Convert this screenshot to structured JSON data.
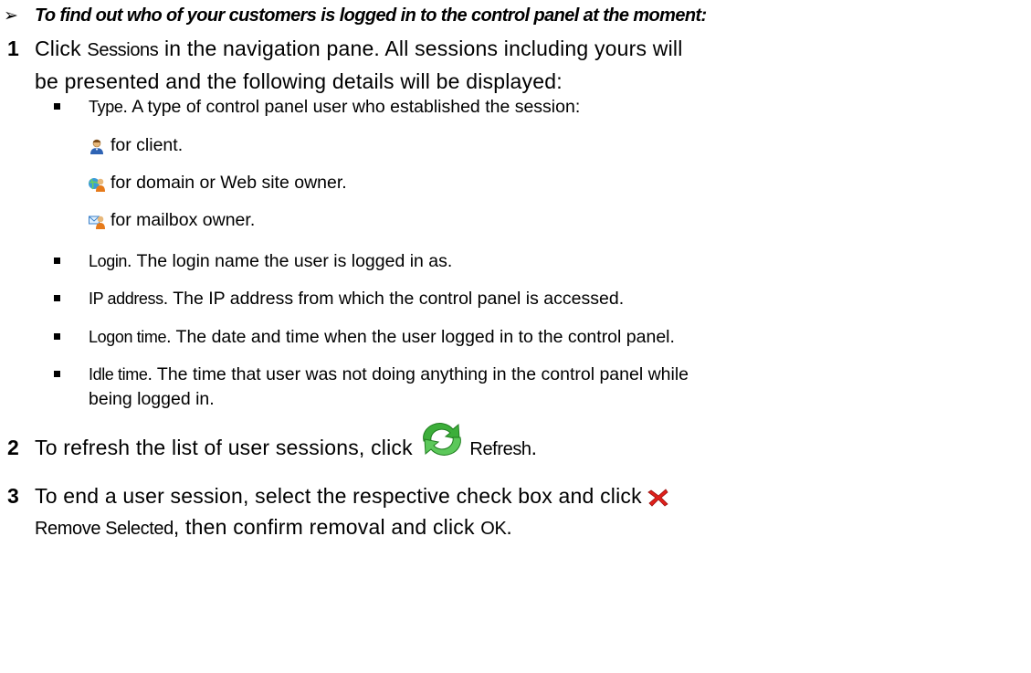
{
  "heading": {
    "arrow": "➢",
    "text": "To find out who of your customers is logged in to the control panel at the moment:"
  },
  "step1": {
    "num": "1",
    "pre": "Click ",
    "ui": "Sessions",
    "post": " in the navigation pane. All sessions including yours will",
    "line2": "be presented and the following details will be displayed:"
  },
  "bullets": {
    "type": {
      "term": "Type",
      "desc": ". A type of control panel user who established the session:"
    },
    "type_items": [
      {
        "icon": "client-user-icon",
        "text": "for client."
      },
      {
        "icon": "domain-owner-icon",
        "text": "for domain or Web site owner."
      },
      {
        "icon": "mailbox-owner-icon",
        "text": "for mailbox owner."
      }
    ],
    "login": {
      "term": "Login",
      "desc": ". The login name the user is logged in as."
    },
    "ip": {
      "term": "IP address",
      "desc": ". The IP address from which the control panel is accessed."
    },
    "logon": {
      "term": "Logon time",
      "desc": ". The date and time when the user logged in to the control panel."
    },
    "idle": {
      "term": "Idle time",
      "desc": ". The time that user was not doing anything in the control panel while",
      "line2": "being logged in."
    }
  },
  "step2": {
    "num": "2",
    "pre": "To refresh the list of user sessions, click ",
    "icon": "refresh-icon",
    "ui": "Refresh",
    "post": "."
  },
  "step3": {
    "num": "3",
    "pre": "To end a user session, select the respective check box and click ",
    "icon": "remove-icon",
    "ui1": "Remove Selected",
    "mid": ", then confirm removal and click ",
    "ui2": "OK",
    "post": "."
  },
  "colors": {
    "refresh_green": "#3cae3a",
    "remove_red": "#e0201b",
    "user_blue": "#2e63b4"
  }
}
